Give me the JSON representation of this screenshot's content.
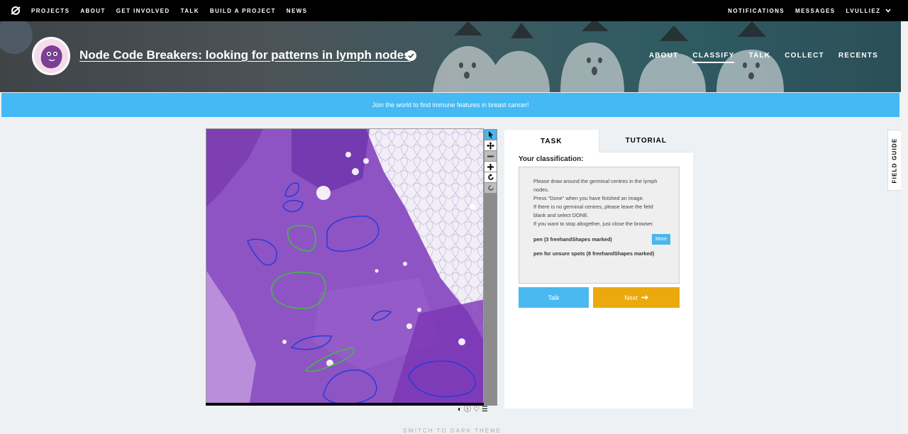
{
  "topnav": {
    "links": [
      "PROJECTS",
      "ABOUT",
      "GET INVOLVED",
      "TALK",
      "BUILD A PROJECT",
      "NEWS"
    ],
    "right": {
      "notifications": "NOTIFICATIONS",
      "messages": "MESSAGES",
      "user": "LVULLIEZ"
    }
  },
  "project": {
    "title": "Node Code Breakers: looking for patterns in lymph nodes",
    "nav": [
      "ABOUT",
      "CLASSIFY",
      "TALK",
      "COLLECT",
      "RECENTS"
    ],
    "active_nav": "CLASSIFY"
  },
  "banner": "Join the world to find immune features in breast cancer!",
  "viewer": {
    "tools": [
      "pointer-icon",
      "pan-icon",
      "zoom-out-icon",
      "zoom-in-icon",
      "rotate-icon",
      "reset-icon"
    ],
    "meta_icons": [
      "invert-icon",
      "info-icon",
      "favorite-icon",
      "collections-icon"
    ]
  },
  "task": {
    "tabs": [
      "TASK",
      "TUTORIAL"
    ],
    "active_tab": "TASK",
    "label": "Your classification:",
    "instructions": [
      "Please draw around the germinal centres in the lymph nodes.",
      "Press \"Done\" when you have finished an image.",
      "If there is no germinal centres, please leave the field blank and select DONE.",
      "If you want to stop altogether, just close the browser."
    ],
    "tools": [
      {
        "label": "pen (3 freehandShapes marked)",
        "more": "More"
      },
      {
        "label": "pen for unsure spots (8 freehandShapes marked)"
      }
    ],
    "buttons": {
      "talk": "Talk",
      "next": "Next"
    }
  },
  "field_guide": "FIELD GUIDE",
  "footer": "SWITCH TO DARK THEME",
  "colors": {
    "accent_blue": "#44b9f4",
    "next_orange": "#eba90e",
    "primary_pen": "#2a3ad8",
    "unsure_pen": "#3cbf3c"
  }
}
